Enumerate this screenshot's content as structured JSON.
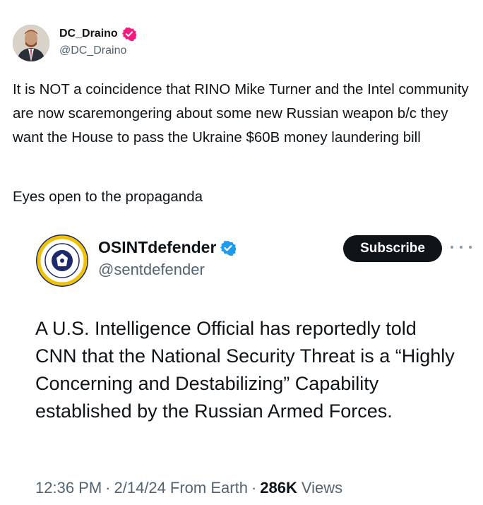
{
  "outer_post": {
    "display_name": "DC_Draino",
    "handle": "@DC_Draino",
    "verified_badge_color": "#f91880",
    "body": "It is NOT a coincidence that RINO Mike Turner and the Intel community are now scaremongering about some new Russian weapon b/c they want the House to pass the Ukraine $60B money laundering bill",
    "body2": "Eyes open to the propaganda"
  },
  "quoted_post": {
    "display_name": "OSINTdefender",
    "handle": "@sentdefender",
    "verified_badge_color": "#1d9bf0",
    "subscribe_label": "Subscribe",
    "more_icon": "more-dots-icon",
    "body": "A U.S. Intelligence Official has reportedly told CNN that the National Security Threat is a “Highly Concerning and Destabilizing” Capability established by the Russian Armed Forces.",
    "time": "12:36 PM",
    "date": "2/14/24",
    "source": "From Earth",
    "views_count": "286K",
    "views_label": "Views"
  }
}
